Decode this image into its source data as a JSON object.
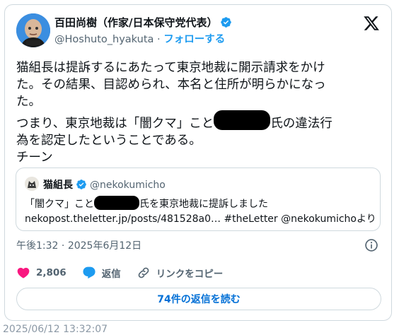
{
  "author": {
    "name": "百田尚樹（作家/日本保守党代表）",
    "handle": "@Hoshuto_hyakuta",
    "separator": "·",
    "follow_label": "フォローする"
  },
  "tweet": {
    "line1": "猫組長は提訴するにあたって東京地裁に開示請求をかけ",
    "line2": "た。その結果、目認められ、本名と住所が明らかになっ",
    "line3": "た。",
    "line4_a": "つまり、東京地裁は「闇クマ」こと",
    "line4_b": "氏の違法行",
    "line5": "為を認定したということである。",
    "line6": "チーン"
  },
  "quote": {
    "name": "猫組長",
    "handle": "@nekokumicho",
    "text1_a": "「闇クマ」こと",
    "text1_b": "氏を東京地裁に提訴しました",
    "text2": "nekopost.theletter.jp/posts/481528a0… #theLetter @nekokumichoより"
  },
  "meta": {
    "time": "午後1:32",
    "separator": "·",
    "date": "2025年6月12日"
  },
  "actions": {
    "likes": "2,806",
    "reply_label": "返信",
    "copy_link_label": "リンクをコピー"
  },
  "read_replies_label": "74件の返信を読む",
  "cut_text": "2025/06/12 13:32:07",
  "colors": {
    "accent": "#1d9bf0",
    "like": "#f91880",
    "border": "#cfd9de",
    "muted": "#536471"
  },
  "icons": [
    "verified-badge-icon",
    "x-logo-icon",
    "info-icon",
    "heart-icon",
    "reply-icon",
    "link-icon"
  ]
}
